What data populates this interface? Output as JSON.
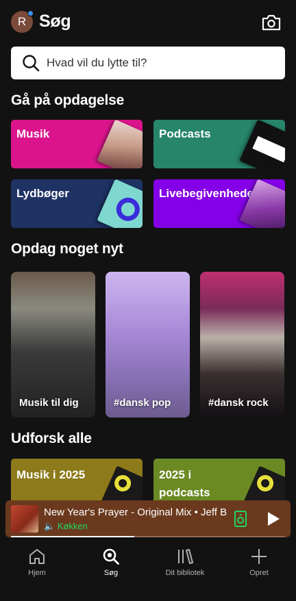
{
  "header": {
    "avatar_initial": "R",
    "title": "Søg",
    "camera_icon": "camera-icon"
  },
  "search": {
    "placeholder": "Hvad vil du lytte til?",
    "icon": "search-icon"
  },
  "sections": {
    "discover_start": "Gå på opdagelse",
    "discover_new": "Opdag noget nyt",
    "browse_all": "Udforsk alle"
  },
  "start_tiles": [
    {
      "label": "Musik",
      "color": "#dc148c"
    },
    {
      "label": "Podcasts",
      "color": "#27856a"
    },
    {
      "label": "Lydbøger",
      "color": "#1e3264"
    },
    {
      "label": "Livebegivenheder",
      "color": "#8400e7"
    }
  ],
  "discover_cards": [
    {
      "label": "Musik til dig"
    },
    {
      "label": "#dansk pop"
    },
    {
      "label": "#dansk rock"
    }
  ],
  "browse_tiles": [
    {
      "label": "Musik i 2025",
      "color": "#8d7a1a"
    },
    {
      "label": "2025 i podcasts",
      "color": "#6b8a23"
    }
  ],
  "player": {
    "track": "New Year's Prayer - Original Mix • Jeff Bu",
    "device": "Køkken",
    "progress": 0.45
  },
  "nav": {
    "home": "Hjem",
    "search": "Søg",
    "library": "Dit bibliotek",
    "create": "Opret"
  }
}
